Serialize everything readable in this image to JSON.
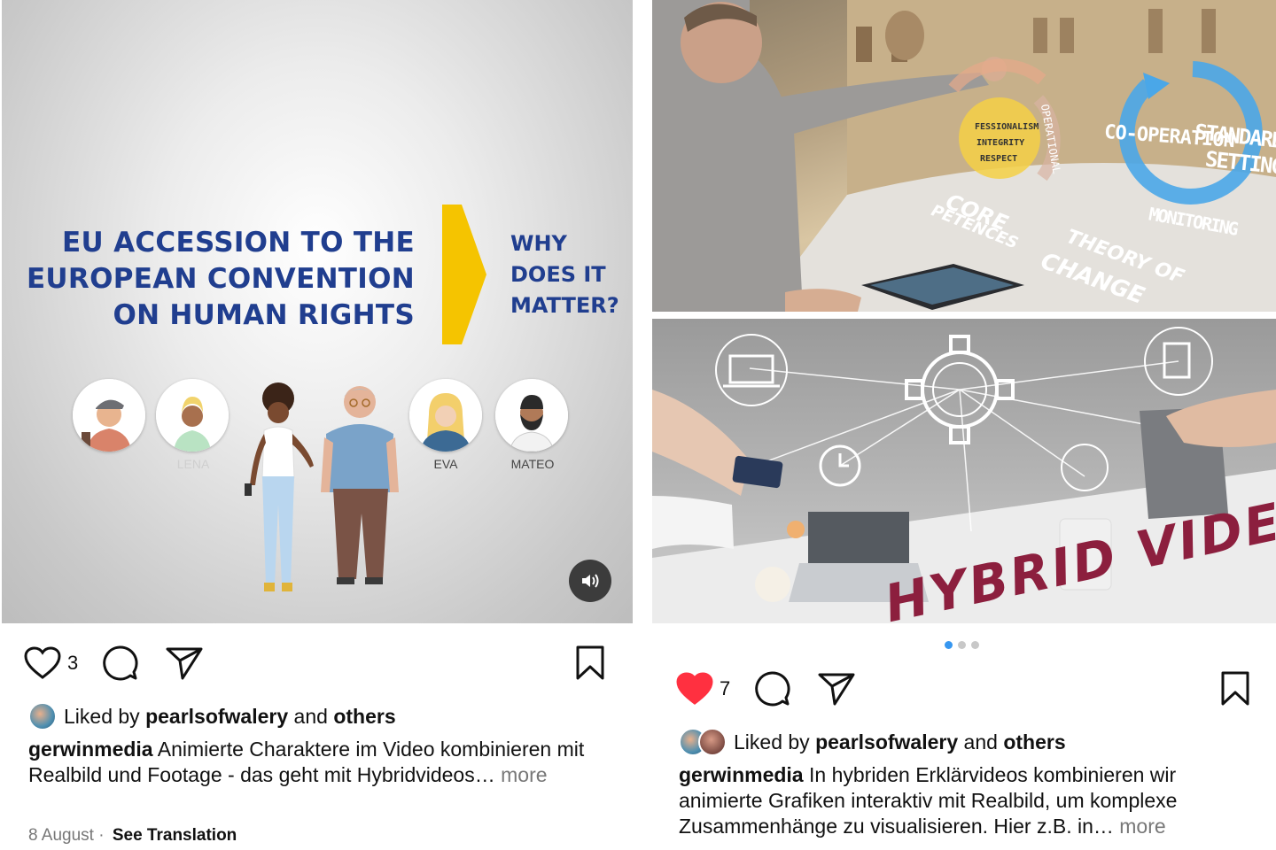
{
  "left_post": {
    "video": {
      "title_lines": [
        "EU ACCESSION TO THE",
        "EUROPEAN CONVENTION",
        "ON HUMAN RIGHTS"
      ],
      "question_lines": [
        "WHY",
        "DOES IT",
        "MATTER?"
      ],
      "characters": [
        "LENA",
        "EVA",
        "MATEO"
      ],
      "sound_icon": "speaker-icon"
    },
    "likes_count": "3",
    "liked_by": {
      "prefix": "Liked by",
      "user": "pearlsofwalery",
      "joiner": "and",
      "others": "others"
    },
    "caption": {
      "user": "gerwinmedia",
      "text": "Animierte Charaktere im Video kombinieren mit Realbild und Footage - das geht mit Hybridvideos…",
      "more": "more"
    },
    "date": "8 August",
    "separator": "·",
    "see_translation": "See Translation"
  },
  "right_post": {
    "carousel": {
      "top_labels": {
        "cooperation": "CO-OPERATION",
        "standard": "STANDARD",
        "setting": "SETTING",
        "monitoring": "MONITORING",
        "core_1": "CORE",
        "core_2": "PETENCES",
        "theory_1": "THEORY OF",
        "theory_2": "CHANGE",
        "operational": "OPERATIONAL",
        "professionalism": "FESSIONALISM",
        "integrity": "INTEGRITY",
        "respect": "RESPECT"
      },
      "bottom_label": "HYBRID VIDEO",
      "page_count": 3,
      "active_page": 1
    },
    "likes_count": "7",
    "liked": true,
    "liked_by": {
      "prefix": "Liked by",
      "user": "pearlsofwalery",
      "joiner": "and",
      "others": "others"
    },
    "caption": {
      "user": "gerwinmedia",
      "text": "In hybriden Erklärvideos kombinieren wir animierte Grafiken interaktiv mit Realbild, um komplexe Zusammenhänge zu visualisieren. Hier z.B. in…",
      "more": "more"
    }
  },
  "colors": {
    "title_blue": "#203e8f",
    "arrow_yellow": "#f5c400",
    "like_red": "#ff3040",
    "carousel_active": "#3797f0",
    "hybrid_text": "#8c1f3e"
  }
}
